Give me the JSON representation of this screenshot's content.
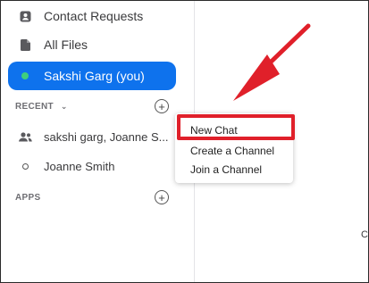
{
  "sidebar": {
    "items": [
      {
        "label": "Contact Requests",
        "icon": "contact-requests-icon"
      },
      {
        "label": "All Files",
        "icon": "file-icon"
      },
      {
        "label": "Sakshi Garg (you)",
        "icon": "presence-dot-icon",
        "active": true
      }
    ],
    "recent": {
      "label": "RECENT",
      "chats": [
        {
          "label": "sakshi garg, Joanne S...",
          "icon": "group-icon"
        },
        {
          "label": "Joanne Smith",
          "icon": "status-ring-icon"
        }
      ]
    },
    "apps": {
      "label": "APPS"
    }
  },
  "context_menu": {
    "items": [
      "New Chat",
      "Create a Channel",
      "Join a Channel"
    ]
  },
  "main": {
    "edge_text": "C"
  },
  "colors": {
    "active_bg": "#0e72ed",
    "presence": "#3fcf7d",
    "annotation": "#e0202a"
  }
}
